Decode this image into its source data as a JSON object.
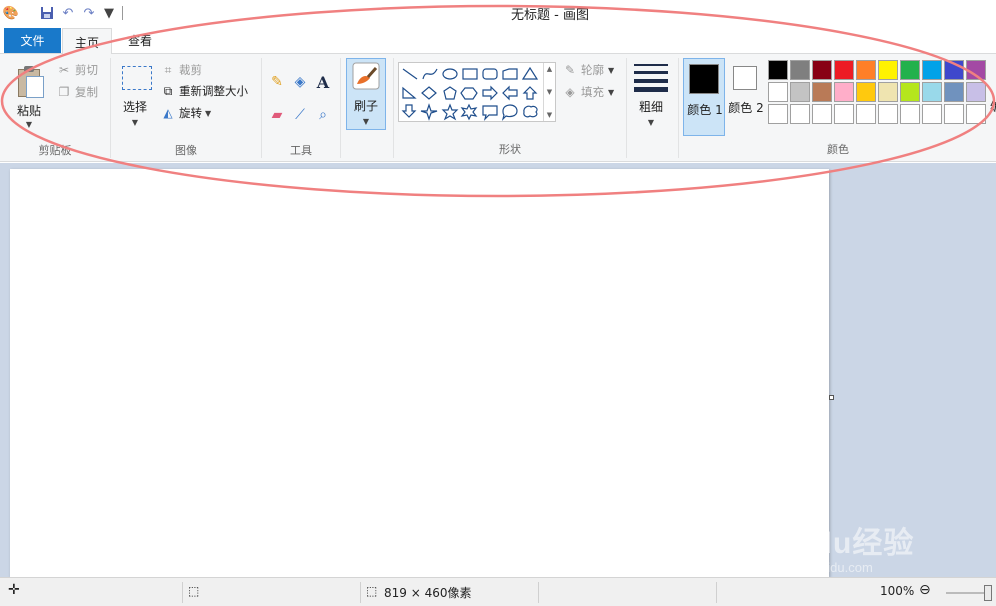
{
  "window": {
    "title": "无标题 - 画图"
  },
  "tabs": {
    "file": "文件",
    "home": "主页",
    "view": "查看"
  },
  "clipboard": {
    "paste": "粘贴",
    "cut": "剪切",
    "copy": "复制",
    "group_label": "剪贴板"
  },
  "image": {
    "select": "选择",
    "crop": "裁剪",
    "resize": "重新调整大小",
    "rotate": "旋转",
    "group_label": "图像"
  },
  "tools": {
    "group_label": "工具",
    "text_glyph": "A"
  },
  "brushes": {
    "label": "刷子"
  },
  "shapes": {
    "outline": "轮廓",
    "fill": "填充",
    "group_label": "形状"
  },
  "size": {
    "label": "粗细"
  },
  "colors": {
    "color1": "颜色 1",
    "color2": "颜色 2",
    "edit_label": "编",
    "group_label": "颜色",
    "color1_value": "#000000",
    "color2_value": "#ffffff",
    "palette_row1": [
      "#000000",
      "#7f7f7f",
      "#880015",
      "#ed1c24",
      "#ff7f27",
      "#fff200",
      "#22b14c",
      "#00a2e8",
      "#3f48cc",
      "#a349a4"
    ],
    "palette_row2": [
      "#ffffff",
      "#c3c3c3",
      "#b97a57",
      "#ffaec9",
      "#ffc90e",
      "#efe4b0",
      "#b5e61d",
      "#99d9ea",
      "#7092be",
      "#c8bfe7"
    ],
    "palette_row3": [
      "#ffffff",
      "#ffffff",
      "#ffffff",
      "#ffffff",
      "#ffffff",
      "#ffffff",
      "#ffffff",
      "#ffffff",
      "#ffffff",
      "#ffffff"
    ]
  },
  "status": {
    "image_size": "819 × 460像素",
    "zoom": "100%"
  },
  "watermark": {
    "main": "Baidu经验",
    "sub": "jingyan.baidu.com"
  },
  "accent": {
    "file_tab": "#1979ca",
    "selected_button": "#cce4f7",
    "annotation": "#f08080"
  }
}
